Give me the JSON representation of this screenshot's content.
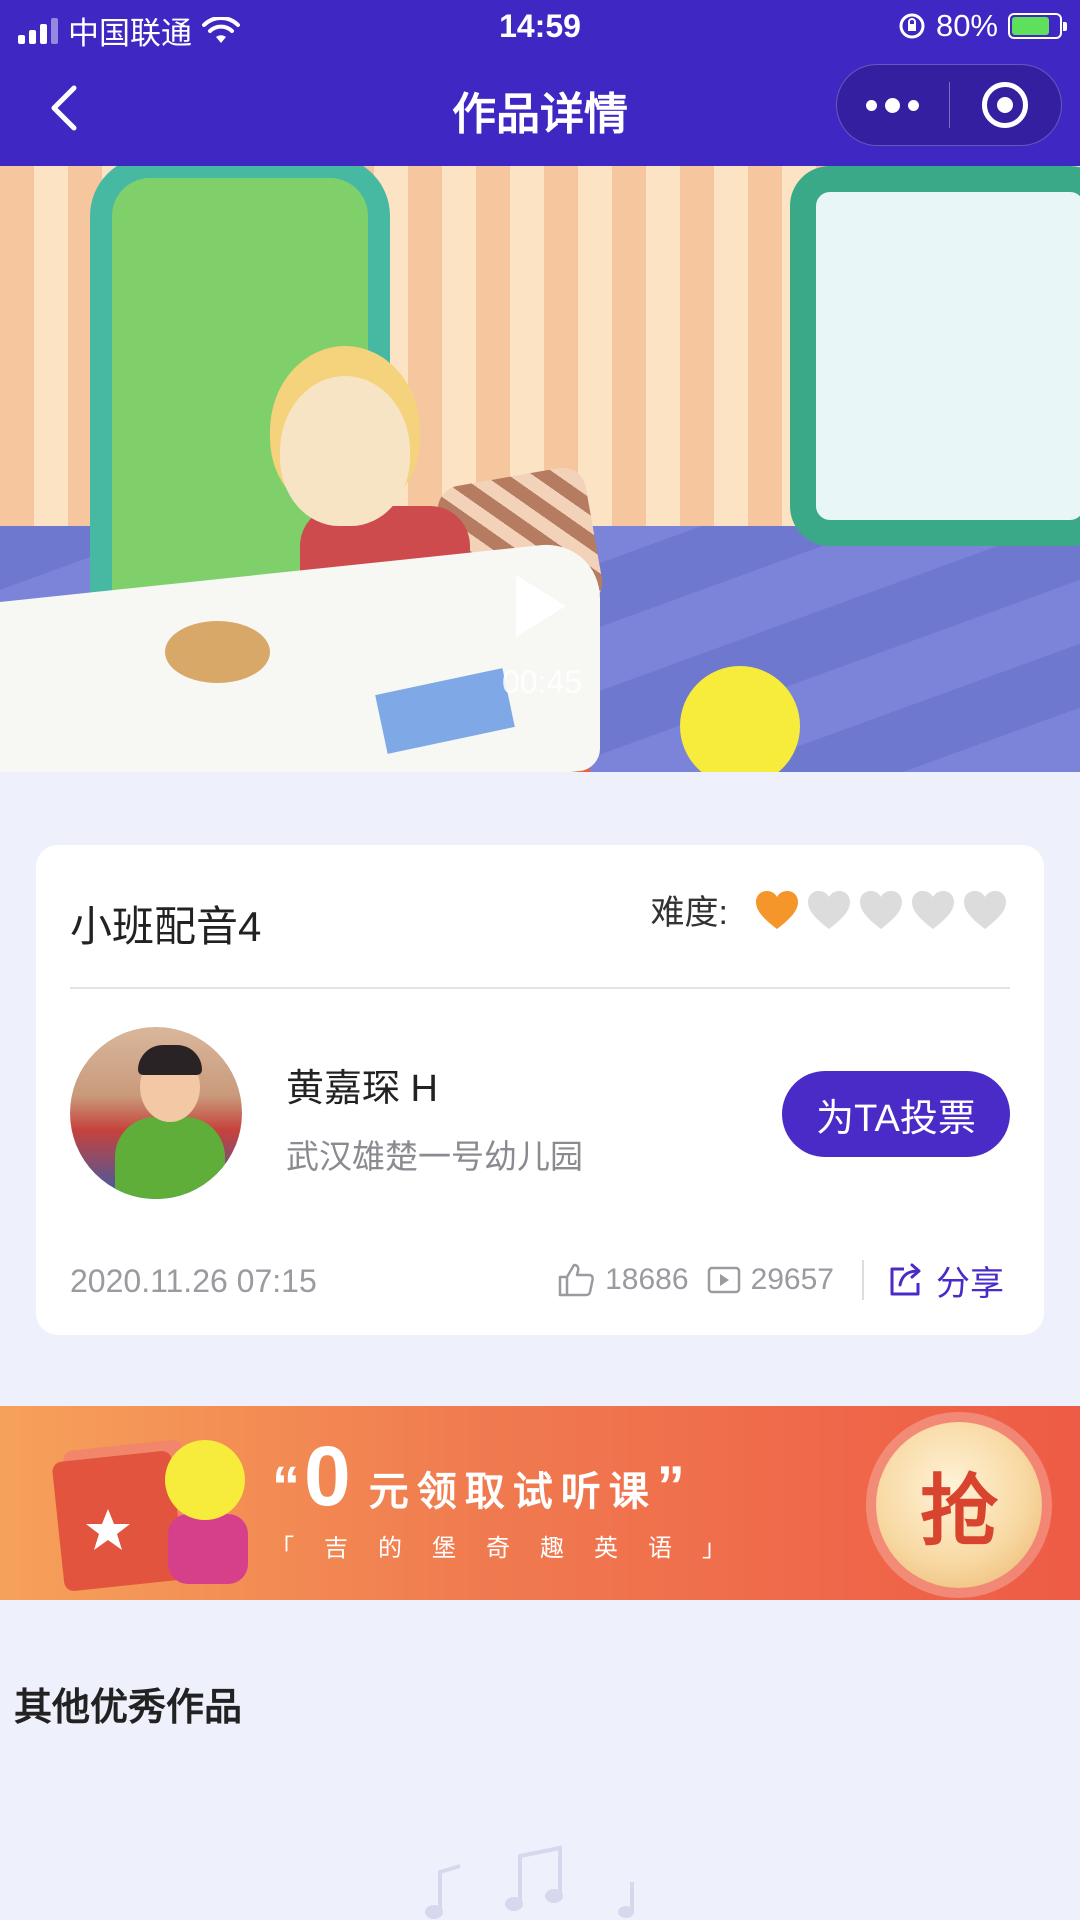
{
  "status_bar": {
    "carrier": "中国联通",
    "time": "14:59",
    "battery": "80%",
    "battery_level": 0.8
  },
  "nav": {
    "title": "作品详情",
    "back_icon": "chevron-left-icon",
    "more_icon": "more-dots-icon",
    "close_icon": "target-circle-icon"
  },
  "video": {
    "duration": "00:45",
    "play_icon": "play-icon"
  },
  "work": {
    "title": "小班配音4",
    "difficulty_label": "难度:",
    "difficulty_level": 1,
    "difficulty_max": 5,
    "author_name": "黄嘉琛 H",
    "author_school": "武汉雄楚一号幼儿园",
    "vote_label": "为TA投票",
    "date": "2020.11.26 07:15",
    "likes": "18686",
    "plays": "29657",
    "share_label": "分享",
    "colors": {
      "accent": "#4b2bc8",
      "heart_active": "#f5962a",
      "heart_inactive": "#dcdcdc"
    }
  },
  "promo": {
    "quote_open": "“",
    "zero": "0",
    "title": "元领取试听课",
    "quote_close": "”",
    "subtitle": "「吉的堡奇趣英语」",
    "grab_label": "抢"
  },
  "section": {
    "title": "其他优秀作品"
  }
}
